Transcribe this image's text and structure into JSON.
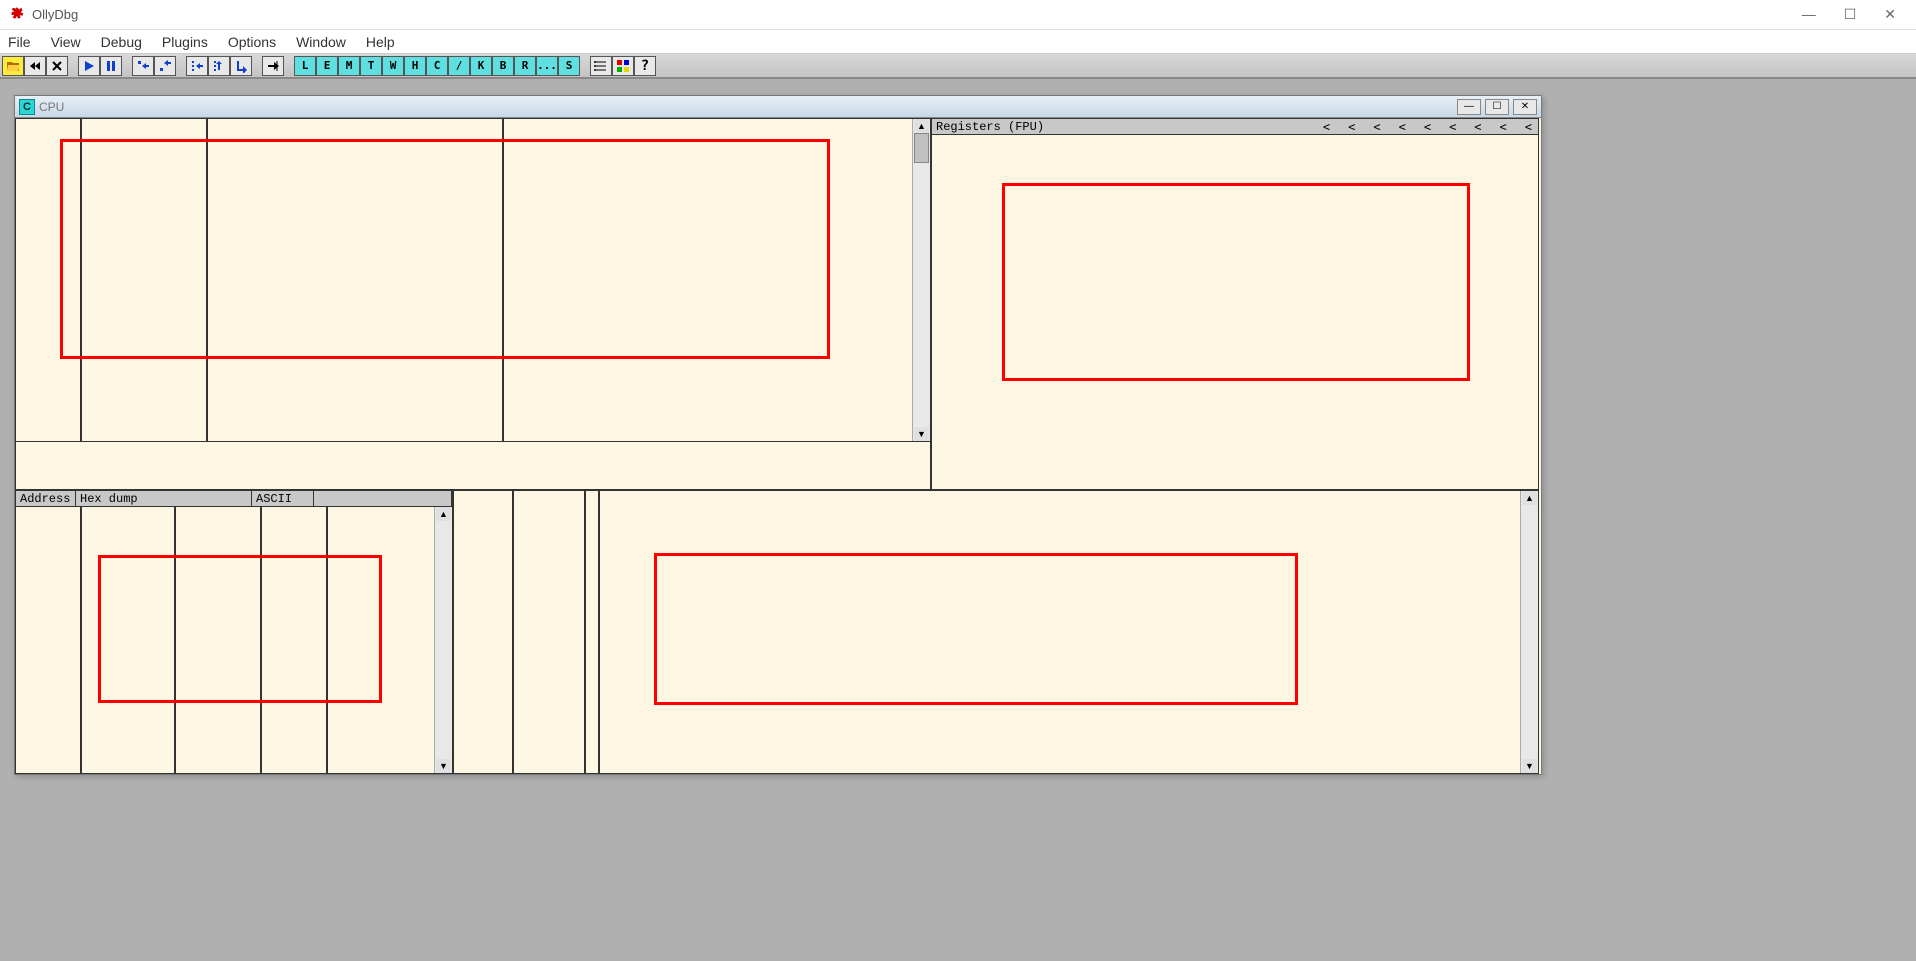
{
  "app": {
    "title": "OllyDbg"
  },
  "menu": {
    "file": "File",
    "view": "View",
    "debug": "Debug",
    "plugins": "Plugins",
    "options": "Options",
    "window": "Window",
    "help": "Help"
  },
  "toolbar": {
    "letters": [
      "L",
      "E",
      "M",
      "T",
      "W",
      "H",
      "C",
      "/",
      "K",
      "B",
      "R",
      "...",
      "S"
    ]
  },
  "cpu_window": {
    "title": "CPU",
    "registers_header": "Registers (FPU)",
    "dump_headers": {
      "address": "Address",
      "hex": "Hex dump",
      "ascii": "ASCII"
    },
    "reg_chevrons": [
      "<",
      "<",
      "<",
      "<",
      "<",
      "<",
      "<",
      "<",
      "<"
    ]
  },
  "win_controls": {
    "minimize": "—",
    "maximize": "☐",
    "close": "✕",
    "child_minimize": "—",
    "child_maximize": "☐",
    "child_close": "✕"
  }
}
